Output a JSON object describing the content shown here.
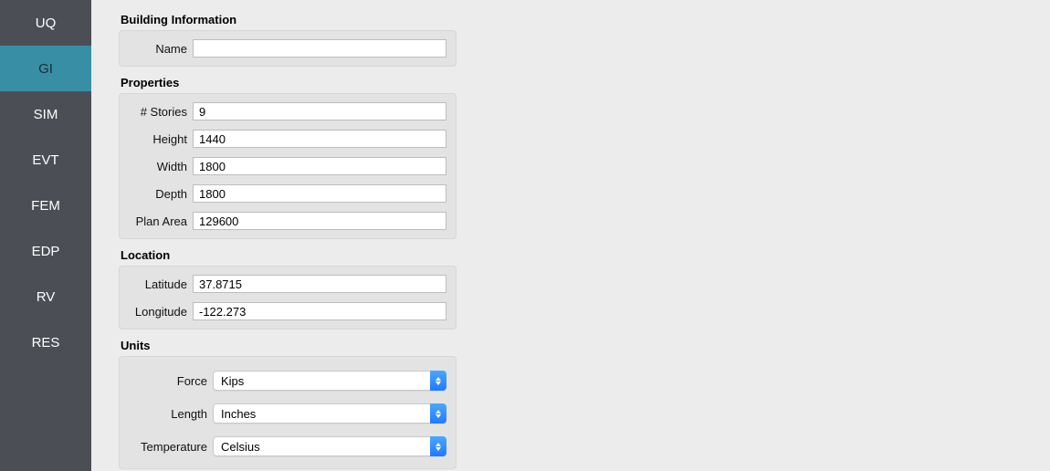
{
  "sidebar": {
    "items": [
      {
        "label": "UQ"
      },
      {
        "label": "GI"
      },
      {
        "label": "SIM"
      },
      {
        "label": "EVT"
      },
      {
        "label": "FEM"
      },
      {
        "label": "EDP"
      },
      {
        "label": "RV"
      },
      {
        "label": "RES"
      }
    ],
    "active_index": 1
  },
  "sections": {
    "building_info": {
      "title": "Building Information",
      "name_label": "Name",
      "name_value": ""
    },
    "properties": {
      "title": "Properties",
      "stories_label": "# Stories",
      "stories_value": "9",
      "height_label": "Height",
      "height_value": "1440",
      "width_label": "Width",
      "width_value": "1800",
      "depth_label": "Depth",
      "depth_value": "1800",
      "plan_area_label": "Plan Area",
      "plan_area_value": "129600"
    },
    "location": {
      "title": "Location",
      "lat_label": "Latitude",
      "lat_value": "37.8715",
      "lon_label": "Longitude",
      "lon_value": "-122.273"
    },
    "units": {
      "title": "Units",
      "force_label": "Force",
      "force_value": "Kips",
      "length_label": "Length",
      "length_value": "Inches",
      "temperature_label": "Temperature",
      "temperature_value": "Celsius"
    }
  }
}
